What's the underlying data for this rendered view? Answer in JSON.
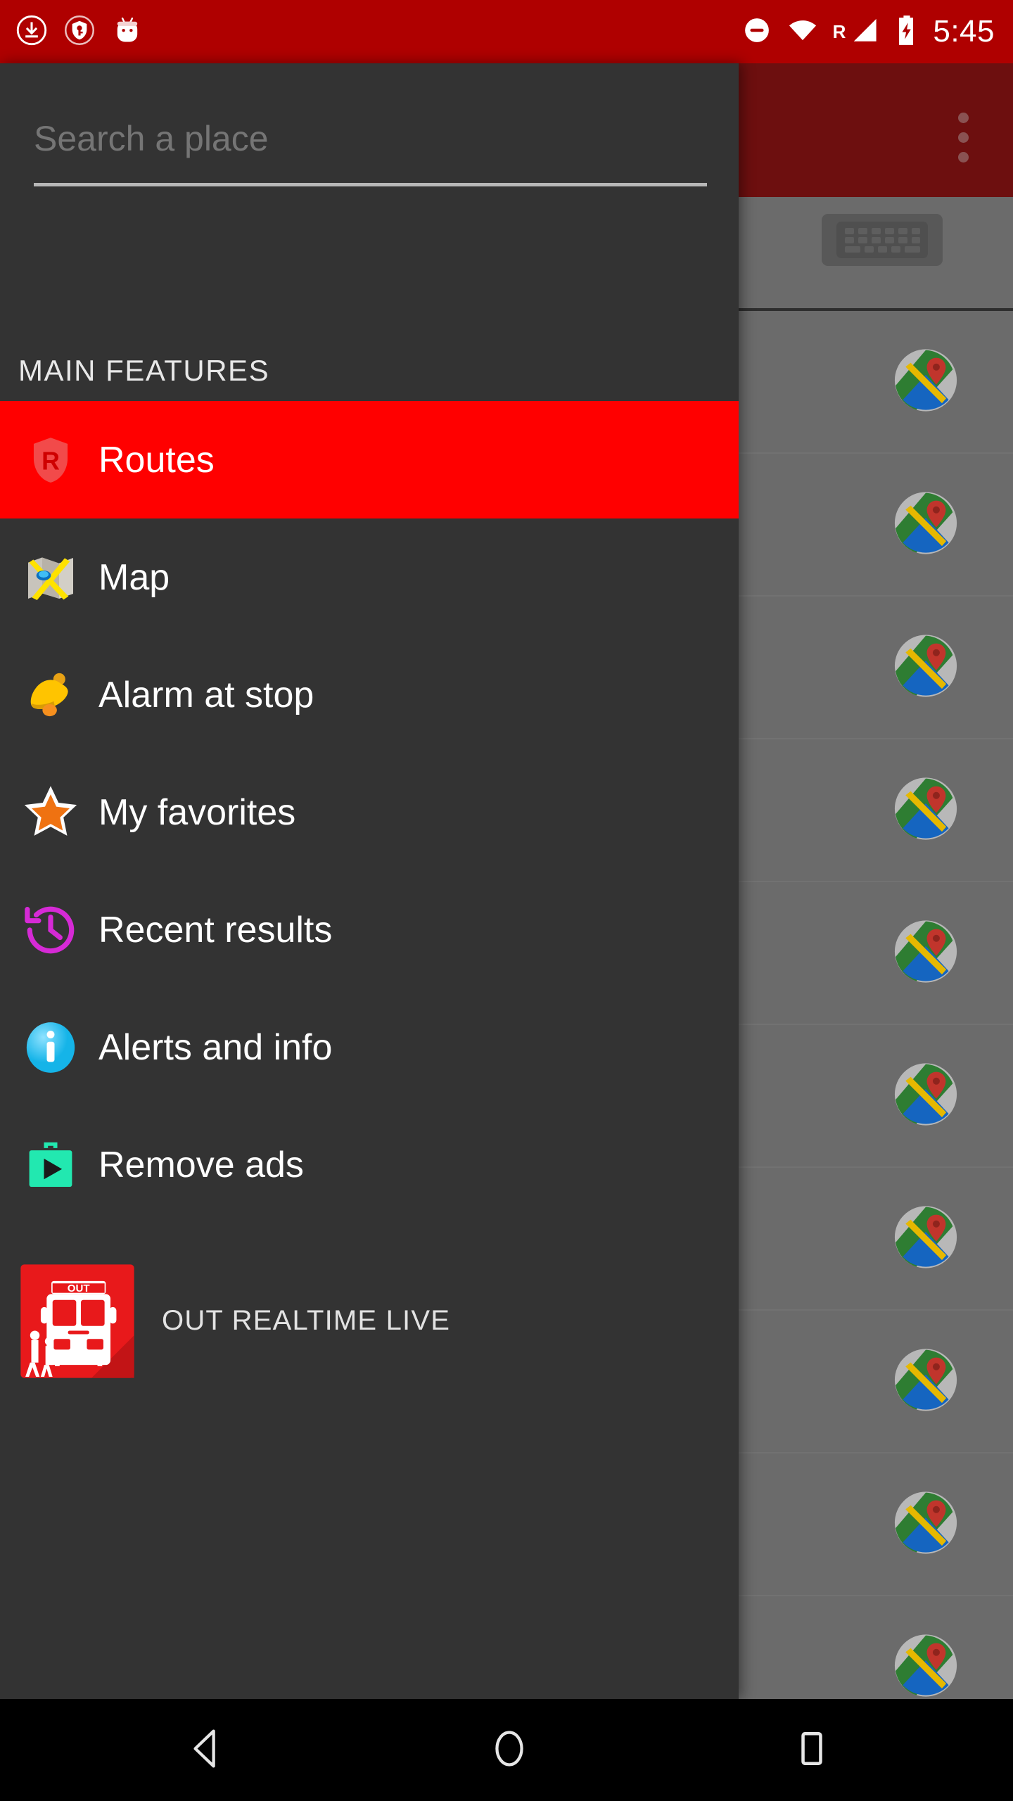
{
  "status_bar": {
    "background_color": "#AF0000",
    "left_icons": [
      {
        "name": "download-icon",
        "glyph": "download"
      },
      {
        "name": "vpn-key-shield-icon",
        "glyph": "vpn"
      },
      {
        "name": "android-head-icon",
        "glyph": "android"
      }
    ],
    "right_icons": [
      {
        "name": "do-not-disturb-icon",
        "glyph": "dnd"
      },
      {
        "name": "wifi-icon",
        "glyph": "wifi"
      },
      {
        "name": "roaming-indicator",
        "label": "R"
      },
      {
        "name": "cell-signal-icon",
        "glyph": "signal"
      },
      {
        "name": "battery-charging-icon",
        "glyph": "battery"
      }
    ],
    "time": "5:45"
  },
  "drawer": {
    "background_color": "#333333",
    "search": {
      "placeholder": "Search a place",
      "value": ""
    },
    "section_header": "MAIN FEATURES",
    "items": [
      {
        "label": "Routes",
        "icon": "routes-shield-icon",
        "selected": true,
        "highlight_color": "#FF0000"
      },
      {
        "label": "Map",
        "icon": "folded-map-icon",
        "selected": false
      },
      {
        "label": "Alarm at stop",
        "icon": "bell-icon",
        "selected": false
      },
      {
        "label": "My favorites",
        "icon": "star-icon",
        "selected": false
      },
      {
        "label": "Recent results",
        "icon": "history-clock-icon",
        "selected": false
      },
      {
        "label": "Alerts and info",
        "icon": "info-circle-icon",
        "selected": false
      },
      {
        "label": "Remove ads",
        "icon": "google-play-bag-icon",
        "selected": false
      }
    ],
    "promo": {
      "label": "OUT REALTIME LIVE",
      "icon": "out-bus-app-icon",
      "icon_badge_text": "OUT",
      "icon_background_color": "#E8191B"
    }
  },
  "background_screen": {
    "appbar_color": "#6d0f0f",
    "overflow_menu": "overflow-menu-icon",
    "keyboard_button": "keyboard-icon",
    "list_rows": [
      {
        "icon": "google-maps-icon"
      },
      {
        "icon": "google-maps-icon"
      },
      {
        "icon": "google-maps-icon"
      },
      {
        "icon": "google-maps-icon"
      },
      {
        "icon": "google-maps-icon"
      },
      {
        "icon": "google-maps-icon"
      },
      {
        "icon": "google-maps-icon"
      },
      {
        "icon": "google-maps-icon"
      },
      {
        "icon": "google-maps-icon"
      },
      {
        "icon": "google-maps-icon"
      }
    ]
  },
  "navigation_bar": {
    "background_color": "#000000",
    "buttons": [
      {
        "name": "back-button",
        "glyph": "triangle-left"
      },
      {
        "name": "home-button",
        "glyph": "circle"
      },
      {
        "name": "recents-button",
        "glyph": "square"
      }
    ]
  }
}
